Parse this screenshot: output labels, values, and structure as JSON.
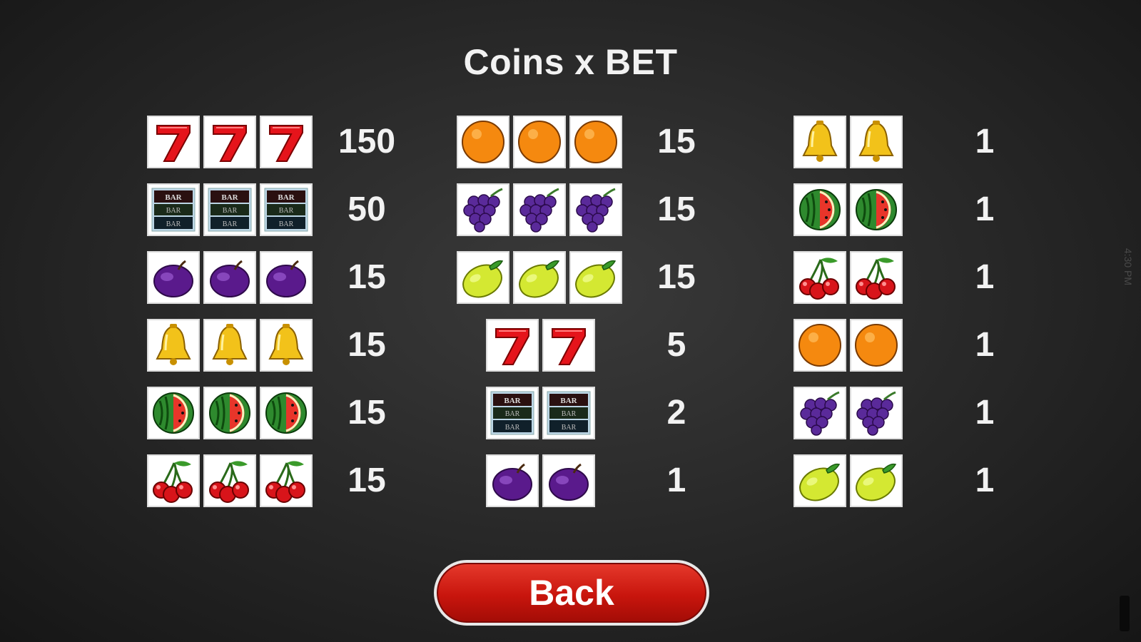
{
  "title": "Coins x BET",
  "back_label": "Back",
  "status_time": "4:30 PM",
  "columns": [
    {
      "rows": [
        {
          "symbols": [
            "seven",
            "seven",
            "seven"
          ],
          "payout": "150"
        },
        {
          "symbols": [
            "bar",
            "bar",
            "bar"
          ],
          "payout": "50"
        },
        {
          "symbols": [
            "plum",
            "plum",
            "plum"
          ],
          "payout": "15"
        },
        {
          "symbols": [
            "bell",
            "bell",
            "bell"
          ],
          "payout": "15"
        },
        {
          "symbols": [
            "watermelon",
            "watermelon",
            "watermelon"
          ],
          "payout": "15"
        },
        {
          "symbols": [
            "cherry",
            "cherry",
            "cherry"
          ],
          "payout": "15"
        }
      ]
    },
    {
      "rows": [
        {
          "symbols": [
            "orange",
            "orange",
            "orange"
          ],
          "payout": "15"
        },
        {
          "symbols": [
            "grape",
            "grape",
            "grape"
          ],
          "payout": "15"
        },
        {
          "symbols": [
            "lemon",
            "lemon",
            "lemon"
          ],
          "payout": "15"
        },
        {
          "symbols": [
            "seven",
            "seven"
          ],
          "payout": "5"
        },
        {
          "symbols": [
            "bar",
            "bar"
          ],
          "payout": "2"
        },
        {
          "symbols": [
            "plum",
            "plum"
          ],
          "payout": "1"
        }
      ]
    },
    {
      "rows": [
        {
          "symbols": [
            "bell",
            "bell"
          ],
          "payout": "1"
        },
        {
          "symbols": [
            "watermelon",
            "watermelon"
          ],
          "payout": "1"
        },
        {
          "symbols": [
            "cherry",
            "cherry"
          ],
          "payout": "1"
        },
        {
          "symbols": [
            "orange",
            "orange"
          ],
          "payout": "1"
        },
        {
          "symbols": [
            "grape",
            "grape"
          ],
          "payout": "1"
        },
        {
          "symbols": [
            "lemon",
            "lemon"
          ],
          "payout": "1"
        }
      ]
    }
  ],
  "colors": {
    "background": "#2a2a2a",
    "text": "#f2f2f2",
    "button": "#c8150d"
  }
}
